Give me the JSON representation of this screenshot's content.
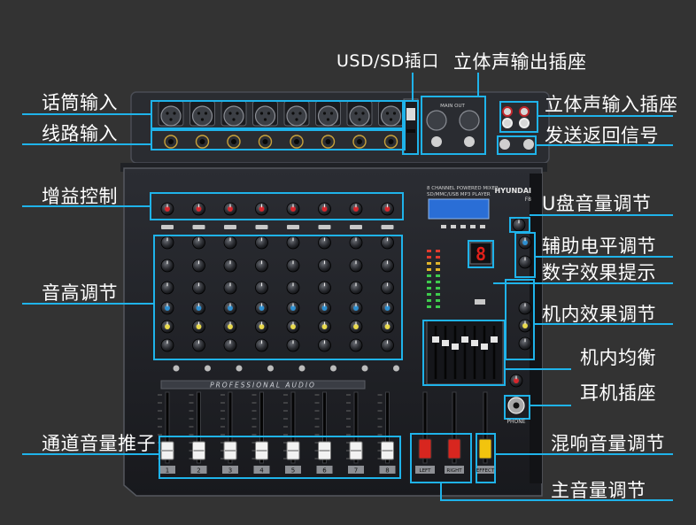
{
  "colors": {
    "background": "#333333",
    "callout": "#1fb3ea",
    "panel": "#1d1e22",
    "label_text": "#ffffff",
    "lcd": "#2a6ed6",
    "led_digit": "#e0201a",
    "fader_white": "#f2f2f2",
    "fader_red": "#d8261f",
    "fader_yellow": "#f2c40e"
  },
  "device": {
    "brand": "HYUNDAI",
    "model": "F8",
    "subtitle_1": "8 CHANNEL POWERED MIXER",
    "subtitle_2": "SD/MMC/USB MP3 PLAYER",
    "strip_text": "PROFESSIONAL AUDIO",
    "main_out_label": "MAIN OUT",
    "phone_label": "PHONE",
    "led_display": "8",
    "channel_numbers": [
      "1",
      "2",
      "3",
      "4",
      "5",
      "6",
      "7",
      "8"
    ],
    "master_buttons": [
      "LEFT",
      "RIGHT",
      "EFFECT"
    ]
  },
  "callouts": {
    "mic_input": "话筒输入",
    "line_input": "线路输入",
    "usb_sd_slot": "USD/SD插口",
    "stereo_output": "立体声输出插座",
    "stereo_input": "立体声输入插座",
    "send_return": "发送返回信号",
    "gain_control": "增益控制",
    "usb_volume": "U盘音量调节",
    "aux_level": "辅助电平调节",
    "digital_effect_display": "数字效果提示",
    "tone_control": "音高调节",
    "internal_effect": "机内效果调节",
    "internal_eq": "机内均衡",
    "headphone_jack": "耳机插座",
    "channel_faders": "通道音量推子",
    "reverb_volume": "混响音量调节",
    "master_volume": "主音量调节"
  }
}
